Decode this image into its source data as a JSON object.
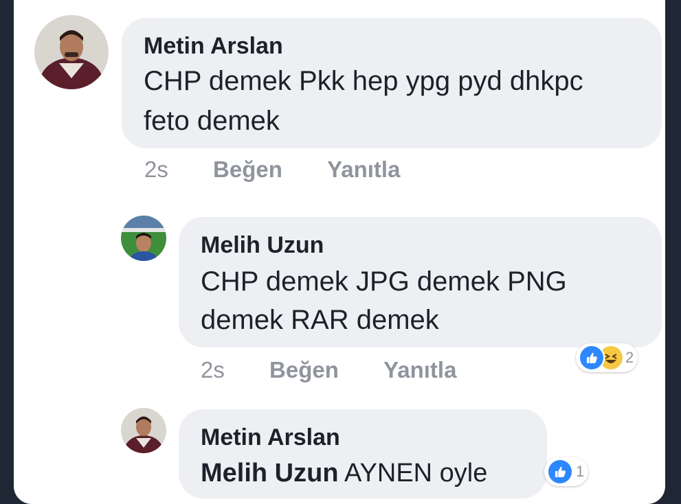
{
  "comments": [
    {
      "author": "Metin Arslan",
      "text_line1": "CHP demek Pkk hep ypg pyd dhkpc",
      "text_line2": "feto demek",
      "time": "2s",
      "like_label": "Beğen",
      "reply_label": "Yanıtla"
    },
    {
      "author": "Melih Uzun",
      "text_line1": "CHP demek JPG demek PNG",
      "text_line2": "demek RAR demek",
      "time": "2s",
      "like_label": "Beğen",
      "reply_label": "Yanıtla",
      "reaction_count": "2",
      "reactions": [
        "like-icon",
        "haha-icon"
      ]
    },
    {
      "author": "Metin Arslan",
      "mention": "Melih Uzun",
      "text": "AYNEN oyle",
      "reaction_count": "1",
      "reactions": [
        "like-icon"
      ]
    }
  ],
  "colors": {
    "background": "#1e2733",
    "card": "#ffffff",
    "bubble": "#eeeff2",
    "text": "#1d2129",
    "meta": "#90949c",
    "like_blue": "#2d88ff",
    "haha_yellow": "#f7c843"
  }
}
